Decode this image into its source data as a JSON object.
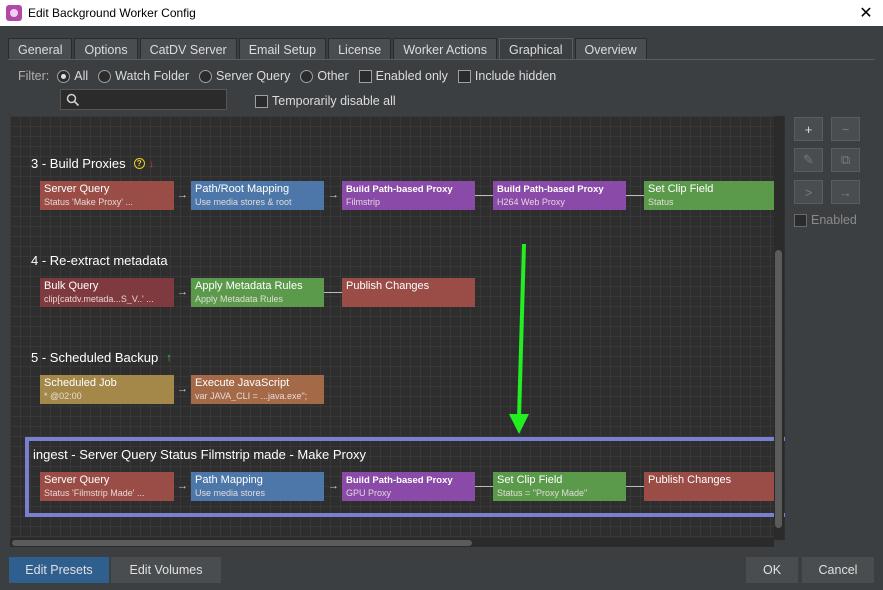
{
  "window": {
    "title": "Edit Background Worker Config",
    "close": "✕"
  },
  "tabs": [
    "General",
    "Options",
    "CatDV Server",
    "Email Setup",
    "License",
    "Worker Actions",
    "Graphical",
    "Overview"
  ],
  "active_tab": "Graphical",
  "filter": {
    "label": "Filter:",
    "radios": [
      {
        "label": "All",
        "checked": true
      },
      {
        "label": "Watch Folder",
        "checked": false
      },
      {
        "label": "Server Query",
        "checked": false
      },
      {
        "label": "Other",
        "checked": false
      }
    ],
    "checks": [
      {
        "label": "Enabled only",
        "checked": false
      },
      {
        "label": "Include hidden",
        "checked": false
      }
    ],
    "search_value": "",
    "temp_disable_label": "Temporarily disable all"
  },
  "groups": [
    {
      "title": "3 - Build Proxies",
      "icons": [
        "help-icon",
        "down-arrow-icon"
      ],
      "nodes": [
        {
          "title": "Server Query",
          "sub": "Status 'Make Proxy' ...",
          "color": "#9a4d46"
        },
        {
          "title": "Path/Root Mapping",
          "sub": "Use media stores & root",
          "color": "#4d77a8"
        },
        {
          "title": "Build Path-based Proxy",
          "sub": "Filmstrip",
          "color": "#8a4aa8"
        },
        {
          "title": "Build Path-based Proxy",
          "sub": "H264 Web Proxy",
          "color": "#8a4aa8"
        },
        {
          "title": "Set Clip Field",
          "sub": "Status",
          "color": "#5a9a4a"
        }
      ]
    },
    {
      "title": "4 - Re-extract metadata",
      "icons": [],
      "nodes": [
        {
          "title": "Bulk Query",
          "sub": "clip[catdv.metada...S_V..' ...",
          "color": "#7f3a40"
        },
        {
          "title": "Apply Metadata Rules",
          "sub": "Apply Metadata Rules",
          "color": "#5a9a4a"
        },
        {
          "title": "Publish Changes",
          "sub": "",
          "color": "#9a4d46"
        }
      ]
    },
    {
      "title": "5 - Scheduled Backup",
      "icons": [
        "up-arrow-icon"
      ],
      "nodes": [
        {
          "title": "Scheduled Job",
          "sub": "* @02:00",
          "color": "#a3884a"
        },
        {
          "title": "Execute JavaScript",
          "sub": "var JAVA_CLI = ...java.exe\";",
          "color": "#a46a48"
        }
      ]
    },
    {
      "title": "ingest - Server Query Status Filmstrip made - Make Proxy",
      "icons": [],
      "selected": true,
      "nodes": [
        {
          "title": "Server Query",
          "sub": "Status 'Filmstrip Made' ...",
          "color": "#9a4d46"
        },
        {
          "title": "Path Mapping",
          "sub": "Use media stores",
          "color": "#4d77a8"
        },
        {
          "title": "Build Path-based Proxy",
          "sub": "GPU Proxy",
          "color": "#8a4aa8"
        },
        {
          "title": "Set Clip Field",
          "sub": "Status = \"Proxy Made\"",
          "color": "#5a9a4a"
        },
        {
          "title": "Publish Changes",
          "sub": "",
          "color": "#9a4d46"
        }
      ]
    }
  ],
  "side_tools": {
    "add": "+",
    "remove": "−",
    "edit": "✎",
    "duplicate": "⧉",
    "split": ">",
    "connect": "→",
    "enabled_label": "Enabled"
  },
  "buttons": {
    "edit_presets": "Edit Presets",
    "edit_volumes": "Edit Volumes",
    "ok": "OK",
    "cancel": "Cancel"
  },
  "colors": {
    "accent": "#2f5f8f",
    "selection": "#7a7fcf",
    "annotation_arrow": "#22ee22"
  }
}
